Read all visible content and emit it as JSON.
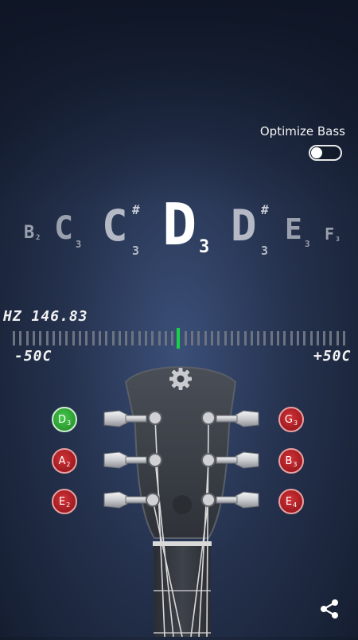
{
  "optimize_bass": {
    "label": "Optimize Bass",
    "enabled": false
  },
  "note_display": {
    "notes": [
      {
        "name": "B",
        "octave": "2",
        "sharp": ""
      },
      {
        "name": "C",
        "octave": "3",
        "sharp": ""
      },
      {
        "name": "C",
        "octave": "3",
        "sharp": "#"
      },
      {
        "name": "D",
        "octave": "3",
        "sharp": ""
      },
      {
        "name": "D",
        "octave": "3",
        "sharp": "#"
      },
      {
        "name": "E",
        "octave": "3",
        "sharp": ""
      },
      {
        "name": "F",
        "octave": "3",
        "sharp": ""
      }
    ],
    "selected_index": 3
  },
  "frequency": {
    "label": "HZ",
    "value": "146.83"
  },
  "meter": {
    "min_label": "-50C",
    "max_label": "+50C",
    "cents": 0
  },
  "strings": {
    "left": [
      {
        "note": "D",
        "octave": "3",
        "status": "green"
      },
      {
        "note": "A",
        "octave": "2",
        "status": "red"
      },
      {
        "note": "E",
        "octave": "2",
        "status": "red"
      }
    ],
    "right": [
      {
        "note": "G",
        "octave": "3",
        "status": "red"
      },
      {
        "note": "B",
        "octave": "3",
        "status": "red"
      },
      {
        "note": "E",
        "octave": "4",
        "status": "red"
      }
    ]
  },
  "icons": {
    "settings": "gear-icon",
    "share": "share-icon"
  },
  "colors": {
    "needle": "#19d24a",
    "tuned": "#2b9a31",
    "untuned": "#9f1b20"
  }
}
